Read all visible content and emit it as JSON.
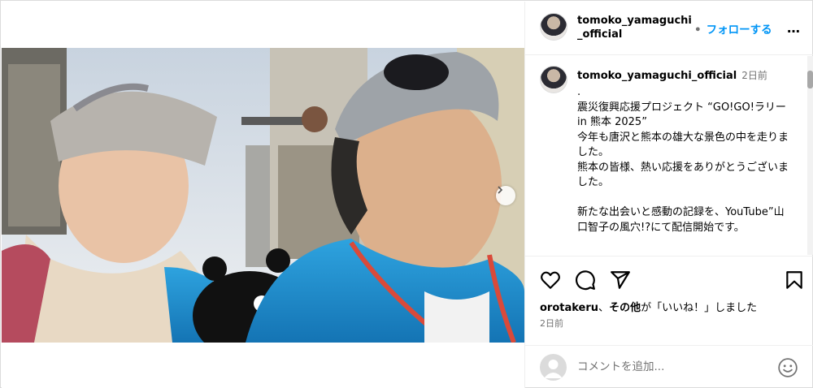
{
  "post": {
    "username": "tomoko_yamaguchi_official",
    "header_username_line1": "tomoko_yamaguchi",
    "header_username_line2": "_official",
    "follow_label": "フォローする",
    "separator": "•",
    "more_icon": "…"
  },
  "caption": {
    "username": "tomoko_yamaguchi_official",
    "time": "2日前",
    "text": ".\n震災復興応援プロジェクト “GO!GO!ラリーin 熊本 2025”\n今年も唐沢と熊本の雄大な景色の中を走りました。\n熊本の皆様、熱い応援をありがとうございました。\n\n新たな出会いと感動の記録を、YouTube”山口智子の風穴!?にて配信開始です。"
  },
  "actions": {
    "icons": [
      "heart-icon",
      "comment-icon",
      "share-icon",
      "bookmark-icon"
    ]
  },
  "likes": {
    "user": "orotakeru",
    "middle": "、",
    "other": "その他",
    "suffix": "が「いいね！」しました"
  },
  "date": "2日前",
  "composer": {
    "placeholder": "コメントを追加..."
  },
  "media": {
    "slide_count": 2,
    "active_slide": 1
  }
}
